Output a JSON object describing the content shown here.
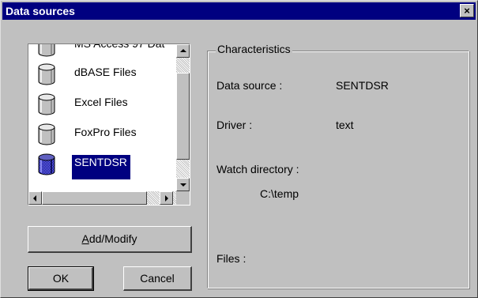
{
  "window": {
    "title": "Data sources",
    "close_label": "×"
  },
  "list": {
    "items": [
      {
        "label": "MS Access 97 Dat",
        "icon": "database-icon",
        "selected": false
      },
      {
        "label": "dBASE Files",
        "icon": "database-icon",
        "selected": false
      },
      {
        "label": "Excel Files",
        "icon": "database-icon",
        "selected": false
      },
      {
        "label": "FoxPro Files",
        "icon": "database-icon",
        "selected": false
      },
      {
        "label": "SENTDSR",
        "icon": "database-selected-icon",
        "selected": true
      }
    ],
    "selection_color": "#000080"
  },
  "buttons": {
    "add_modify_prefix": "",
    "add_modify_hotkey": "A",
    "add_modify_rest": "dd/Modify",
    "ok": "OK",
    "cancel": "Cancel"
  },
  "characteristics": {
    "legend": "Characteristics",
    "data_source_label": "Data source :",
    "data_source_value": "SENTDSR",
    "driver_label": "Driver :",
    "driver_value": "text",
    "watch_directory_label": "Watch directory :",
    "watch_directory_value": "C:\\temp",
    "files_label": "Files :"
  },
  "colors": {
    "title_bar": "#000080",
    "face": "#c0c0c0"
  }
}
